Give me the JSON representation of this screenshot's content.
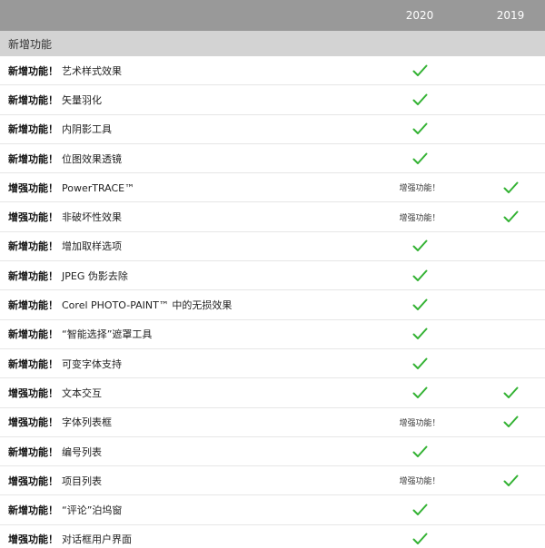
{
  "header": {
    "col_2020": "2020",
    "col_2019": "2019"
  },
  "section": {
    "title": "新增功能"
  },
  "colors": {
    "check": "#33b233",
    "header_bg": "#999999",
    "section_bg": "#d3d3d3"
  },
  "rows": [
    {
      "prefix": "新增功能！",
      "name": "艺术样式效果",
      "v2020": "check",
      "v2019": ""
    },
    {
      "prefix": "新增功能！",
      "name": "矢量羽化",
      "v2020": "check",
      "v2019": ""
    },
    {
      "prefix": "新增功能！",
      "name": "内阴影工具",
      "v2020": "check",
      "v2019": ""
    },
    {
      "prefix": "新增功能！",
      "name": "位图效果透镜",
      "v2020": "check",
      "v2019": ""
    },
    {
      "prefix": "增强功能！",
      "name": "PowerTRACE™",
      "v2020": "增强功能！",
      "v2019": "check"
    },
    {
      "prefix": "增强功能！",
      "name": "非破坏性效果",
      "v2020": "增强功能！",
      "v2019": "check"
    },
    {
      "prefix": "新增功能！",
      "name": "增加取样选项",
      "v2020": "check",
      "v2019": ""
    },
    {
      "prefix": "新增功能！",
      "name": "JPEG 伪影去除",
      "v2020": "check",
      "v2019": ""
    },
    {
      "prefix": "新增功能！",
      "name": "Corel PHOTO-PAINT™ 中的无损效果",
      "v2020": "check",
      "v2019": ""
    },
    {
      "prefix": "新增功能！",
      "name": "“智能选择”遮罩工具",
      "v2020": "check",
      "v2019": ""
    },
    {
      "prefix": "新增功能！",
      "name": "可变字体支持",
      "v2020": "check",
      "v2019": ""
    },
    {
      "prefix": "增强功能！",
      "name": "文本交互",
      "v2020": "check",
      "v2019": "check"
    },
    {
      "prefix": "增强功能！",
      "name": "字体列表框",
      "v2020": "增强功能！",
      "v2019": "check"
    },
    {
      "prefix": "新增功能！",
      "name": "编号列表",
      "v2020": "check",
      "v2019": ""
    },
    {
      "prefix": "增强功能！",
      "name": "项目列表",
      "v2020": "增强功能！",
      "v2019": "check"
    },
    {
      "prefix": "新增功能！",
      "name": "“评论”泊坞窗",
      "v2020": "check",
      "v2019": ""
    },
    {
      "prefix": "增强功能！",
      "name": "对话框用户界面",
      "v2020": "check",
      "v2019": ""
    }
  ]
}
